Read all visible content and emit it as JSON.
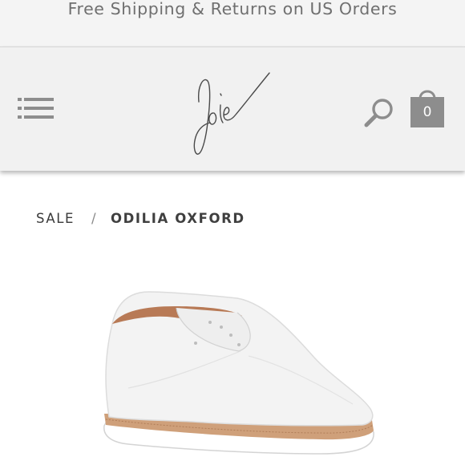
{
  "promo": {
    "text": "Free Shipping & Returns on US Orders"
  },
  "header": {
    "logo_text": "Joie",
    "cart_count": "0"
  },
  "breadcrumb": {
    "items": [
      "SALE",
      "ODILIA OXFORD"
    ],
    "separator": "/"
  },
  "product": {
    "image_alt": "white leather oxford shoe",
    "colors": {
      "shoe": "#f3f3f3",
      "sole": "#ffffff",
      "welt": "#cfa07a",
      "lining": "#b87a56"
    }
  },
  "colors": {
    "header_bg": "#f1f1f1",
    "icon_gray": "#8d8d8d",
    "text_dark": "#3a3a3a"
  }
}
